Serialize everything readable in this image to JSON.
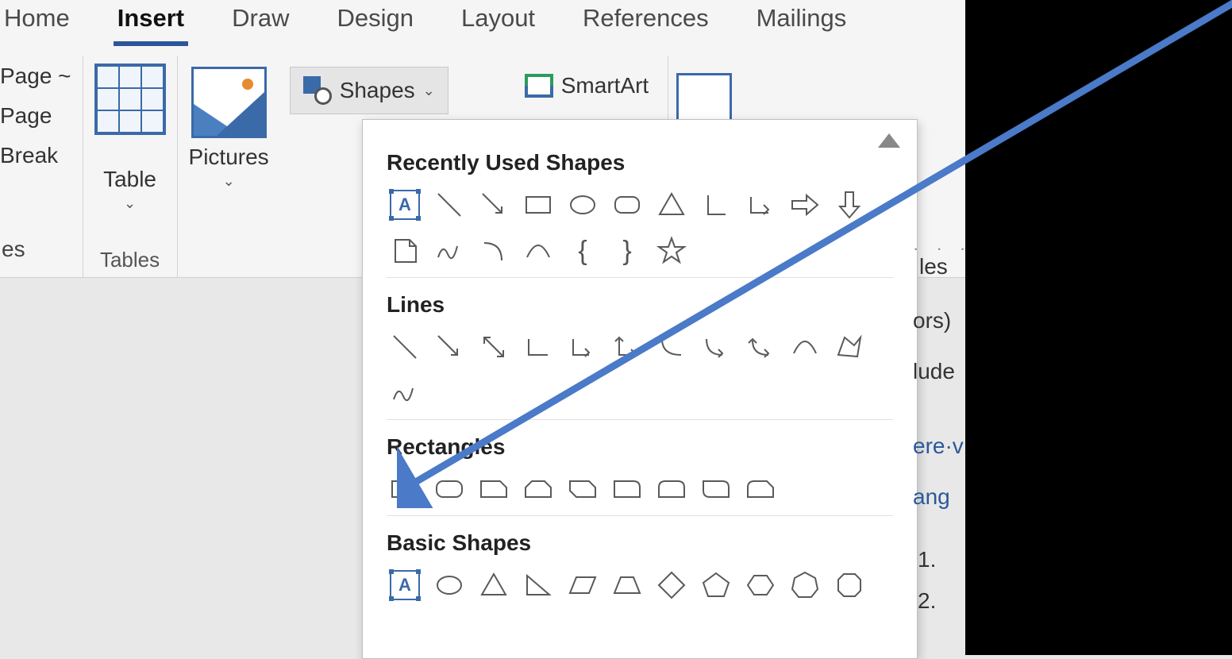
{
  "tabs": [
    "Home",
    "Insert",
    "Draw",
    "Design",
    "Layout",
    "References",
    "Mailings"
  ],
  "activeTab": "Insert",
  "ribbon": {
    "page_items": [
      "Page ~",
      "Page",
      "Break"
    ],
    "page_group_partial_label": "es",
    "table_label": "Table",
    "tables_group": "Tables",
    "pictures_label": "Pictures",
    "shapes_label": "Shapes",
    "smartart_label": "SmartArt",
    "obscured_suffix": "les"
  },
  "shapes_menu": {
    "cat_recent": "Recently Used Shapes",
    "cat_lines": "Lines",
    "cat_rect": "Rectangles",
    "cat_basic": "Basic Shapes",
    "recent": [
      "text-box",
      "line",
      "line-arrow",
      "rectangle",
      "oval",
      "rounded-rectangle",
      "triangle",
      "l-shape",
      "elbow-arrow",
      "right-arrow",
      "down-arrow",
      "document",
      "scribble",
      "arc",
      "curve",
      "left-brace",
      "right-brace",
      "star"
    ],
    "lines": [
      "line",
      "line-arrow",
      "line-double-arrow",
      "elbow",
      "elbow-arrow",
      "elbow-double-arrow",
      "curve-connector",
      "curve-arrow",
      "curve-double-arrow",
      "curve",
      "freeform",
      "scribble"
    ],
    "rectangles": [
      "rectangle",
      "rounded-rectangle",
      "snip-single",
      "snip-same-side",
      "snip-diag",
      "round-single",
      "round-same-side",
      "round-diag",
      "round-snip"
    ],
    "basic_preview": [
      "text-box",
      "oval",
      "triangle",
      "right-triangle",
      "parallelogram",
      "trapezoid",
      "diamond",
      "pentagon",
      "hexagon",
      "heptagon",
      "octagon"
    ]
  },
  "document_snippets": {
    "line1": "ors)",
    "line2": "lude",
    "link1": "ere·v",
    "link2": "ang",
    "list": [
      "1.",
      "2."
    ]
  }
}
